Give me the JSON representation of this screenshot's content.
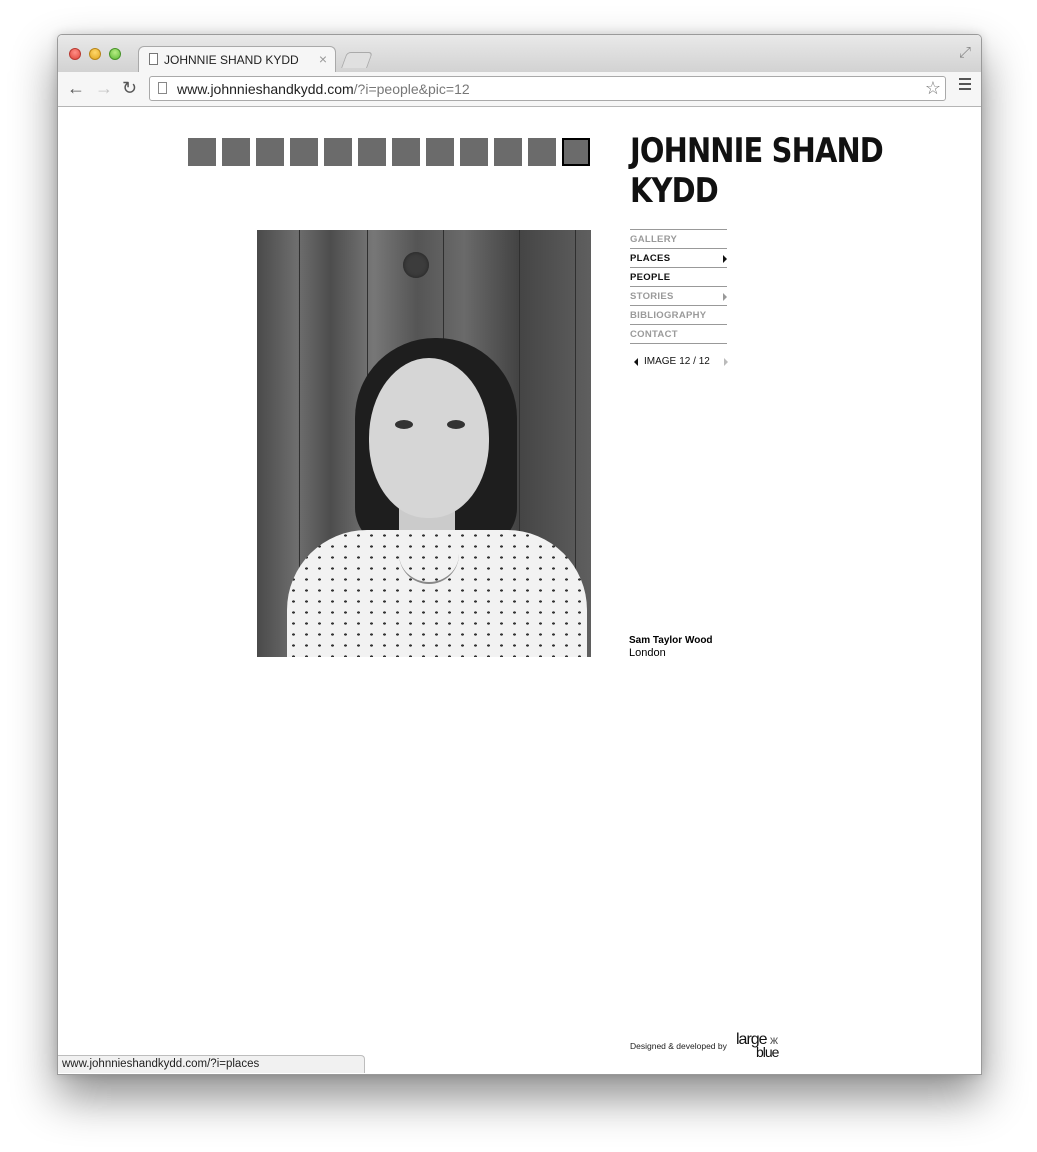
{
  "browser": {
    "tab_title": "JOHNNIE SHAND KYDD",
    "tab_close": "×",
    "url_host": "www.johnnieshandkydd.com",
    "url_rest": "/?i=people&pic=12",
    "star_icon": "☆",
    "back_icon": "←",
    "forward_icon": "→",
    "reload_icon": "↻",
    "fullscreen_icon": "⤢",
    "status_url": "www.johnnieshandkydd.com/?i=places"
  },
  "site": {
    "title": "JOHNNIE SHAND KYDD",
    "nav": [
      {
        "label": "GALLERY",
        "dark": false,
        "arrow": false
      },
      {
        "label": "PLACES",
        "dark": true,
        "arrow": true
      },
      {
        "label": "PEOPLE",
        "dark": true,
        "arrow": false
      },
      {
        "label": "STORIES",
        "dark": false,
        "arrow": true
      },
      {
        "label": "BIBLIOGRAPHY",
        "dark": false,
        "arrow": false
      },
      {
        "label": "CONTACT",
        "dark": false,
        "arrow": false
      }
    ],
    "pager": {
      "label": "IMAGE",
      "current": "12 / 12"
    },
    "caption": {
      "name": "Sam Taylor Wood",
      "place": "London"
    },
    "credit": {
      "text": "Designed & developed by",
      "brand_top": "large",
      "brand_bottom": "blue"
    },
    "thumbnail_count": 12,
    "active_thumbnail": 12
  }
}
